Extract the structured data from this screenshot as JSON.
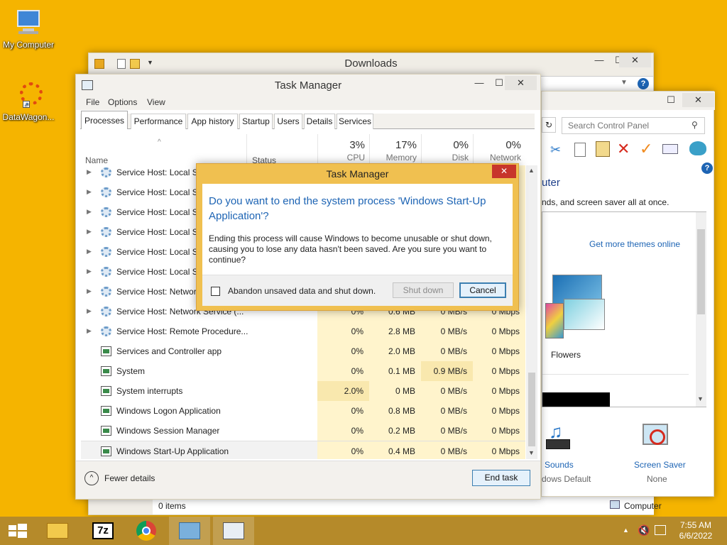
{
  "desktop": {
    "icons": [
      {
        "label": "My Computer"
      },
      {
        "label": "DataWagon..."
      }
    ]
  },
  "downloads_window": {
    "title": "Downloads",
    "status_items": "0 items",
    "status_computer": "Computer"
  },
  "control_panel": {
    "search_placeholder": "Search Control Panel",
    "heading": "uter",
    "description": "nds, and screen saver all at once.",
    "get_more_themes": "Get more themes online",
    "theme_name": "Flowers",
    "sounds_label": "Sounds",
    "sounds_value": "dows Default",
    "screensaver_label": "Screen Saver",
    "screensaver_value": "None"
  },
  "task_manager": {
    "title": "Task Manager",
    "menu": [
      "File",
      "Options",
      "View"
    ],
    "tabs": [
      "Processes",
      "Performance",
      "App history",
      "Startup",
      "Users",
      "Details",
      "Services"
    ],
    "columns": {
      "name": "Name",
      "status": "Status",
      "cpu_pct": "3%",
      "cpu": "CPU",
      "mem_pct": "17%",
      "mem": "Memory",
      "disk_pct": "0%",
      "disk": "Disk",
      "net_pct": "0%",
      "net": "Network"
    },
    "rows": [
      {
        "name": "Service Host: Local Se",
        "cpu": "",
        "mem": "",
        "disk": "",
        "net": "",
        "expand": true,
        "icon": "gear"
      },
      {
        "name": "Service Host: Local Se",
        "cpu": "",
        "mem": "",
        "disk": "",
        "net": "",
        "expand": true,
        "icon": "gear"
      },
      {
        "name": "Service Host: Local Se",
        "cpu": "",
        "mem": "",
        "disk": "",
        "net": "",
        "expand": true,
        "icon": "gear"
      },
      {
        "name": "Service Host: Local Se",
        "cpu": "",
        "mem": "",
        "disk": "",
        "net": "",
        "expand": true,
        "icon": "gear"
      },
      {
        "name": "Service Host: Local Sy",
        "cpu": "",
        "mem": "",
        "disk": "",
        "net": "",
        "expand": true,
        "icon": "gear"
      },
      {
        "name": "Service Host: Local Sy",
        "cpu": "",
        "mem": "",
        "disk": "",
        "net": "",
        "expand": true,
        "icon": "gear"
      },
      {
        "name": "Service Host: Networl",
        "cpu": "",
        "mem": "",
        "disk": "",
        "net": "",
        "expand": true,
        "icon": "gear"
      },
      {
        "name": "Service Host: Network Service (...",
        "cpu": "0%",
        "mem": "0.6 MB",
        "disk": "0 MB/s",
        "net": "0 Mbps",
        "expand": true,
        "icon": "gear"
      },
      {
        "name": "Service Host: Remote Procedure...",
        "cpu": "0%",
        "mem": "2.8 MB",
        "disk": "0 MB/s",
        "net": "0 Mbps",
        "expand": true,
        "icon": "gear"
      },
      {
        "name": "Services and Controller app",
        "cpu": "0%",
        "mem": "2.0 MB",
        "disk": "0 MB/s",
        "net": "0 Mbps",
        "expand": false,
        "icon": "app"
      },
      {
        "name": "System",
        "cpu": "0%",
        "mem": "0.1 MB",
        "disk": "0.9 MB/s",
        "net": "0 Mbps",
        "expand": false,
        "icon": "app"
      },
      {
        "name": "System interrupts",
        "cpu": "2.0%",
        "mem": "0 MB",
        "disk": "0 MB/s",
        "net": "0 Mbps",
        "expand": false,
        "icon": "app"
      },
      {
        "name": "Windows Logon Application",
        "cpu": "0%",
        "mem": "0.8 MB",
        "disk": "0 MB/s",
        "net": "0 Mbps",
        "expand": false,
        "icon": "app"
      },
      {
        "name": "Windows Session Manager",
        "cpu": "0%",
        "mem": "0.2 MB",
        "disk": "0 MB/s",
        "net": "0 Mbps",
        "expand": false,
        "icon": "app"
      },
      {
        "name": "Windows Start-Up Application",
        "cpu": "0%",
        "mem": "0.4 MB",
        "disk": "0 MB/s",
        "net": "0 Mbps",
        "expand": false,
        "icon": "app",
        "selected": true
      }
    ],
    "fewer_details": "Fewer details",
    "end_task": "End task"
  },
  "dialog": {
    "title": "Task Manager",
    "question": "Do you want to end the system process 'Windows Start-Up Application'?",
    "body": "Ending this process will cause Windows to become unusable or shut down, causing you to lose any data hasn't been saved. Are you sure you want to continue?",
    "checkbox_label": "Abandon unsaved data and shut down.",
    "shutdown_label": "Shut down",
    "cancel_label": "Cancel"
  },
  "taskbar": {
    "time": "7:55 AM",
    "date": "6/6/2022",
    "seven_zip_label": "7z"
  },
  "colors": {
    "desktop": "#f5b400",
    "accent_blue": "#1d64b4",
    "dialog_border": "#e8b84a",
    "close_red": "#c7352b",
    "cell_highlight": "#fff4cc",
    "cell_highlight_strong": "#f9e8ae"
  }
}
